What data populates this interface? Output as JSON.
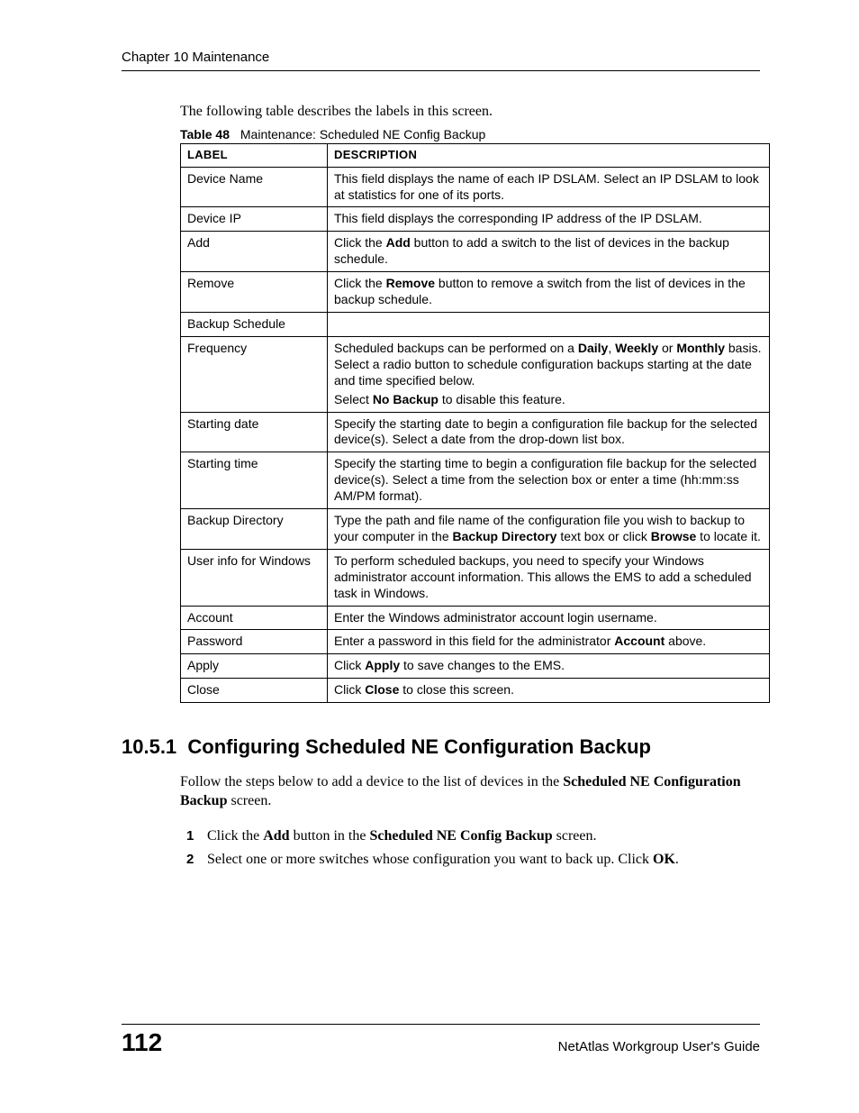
{
  "header": {
    "chapter": "Chapter 10 Maintenance"
  },
  "intro": "The following table describes the labels in this screen.",
  "table": {
    "number": "Table 48",
    "title": "Maintenance: Scheduled NE Config Backup",
    "columns": {
      "label": "LABEL",
      "description": "DESCRIPTION"
    },
    "rows": [
      {
        "label": "Device Name",
        "desc_html": "This field displays the name of each IP DSLAM. Select an IP DSLAM to look at statistics for one of its ports."
      },
      {
        "label": "Device IP",
        "desc_html": "This field displays the corresponding IP address of the IP DSLAM."
      },
      {
        "label": "Add",
        "desc_html": "Click the <b>Add</b> button to add a switch to the list of devices in the backup schedule."
      },
      {
        "label": "Remove",
        "desc_html": "Click the <b>Remove</b> button to remove a switch from the list of devices in the backup schedule."
      },
      {
        "label": "Backup Schedule",
        "desc_html": ""
      },
      {
        "label": "Frequency",
        "desc_html": "Scheduled backups can be performed on a <b>Daily</b>, <b>Weekly</b> or <b>Monthly</b> basis. Select a radio button to schedule configuration backups starting at the date and time specified below.<div class='p2'>Select <b>No Backup</b> to disable this feature.</div>"
      },
      {
        "label": "Starting date",
        "desc_html": "Specify the starting date to begin a configuration file backup for the selected device(s). Select a date from the drop-down list box."
      },
      {
        "label": "Starting time",
        "desc_html": "Specify the starting time to begin a configuration file backup for the selected device(s). Select a time from the selection box or enter a time (hh:mm:ss AM/PM format)."
      },
      {
        "label": "Backup Directory",
        "desc_html": "Type the path and file name of the configuration file you wish to backup to your computer in the <b>Backup Directory</b> text box or click <b>Browse</b> to locate it."
      },
      {
        "label": "User info for Windows",
        "desc_html": "To perform scheduled backups, you need to specify your Windows administrator account information. This allows the EMS to add a scheduled task in Windows."
      },
      {
        "label": "Account",
        "desc_html": "Enter the Windows administrator account login username."
      },
      {
        "label": "Password",
        "desc_html": "Enter a password in this field for the administrator <b>Account</b> above."
      },
      {
        "label": "Apply",
        "desc_html": "Click <b>Apply</b> to save changes to the EMS."
      },
      {
        "label": "Close",
        "desc_html": "Click <b>Close</b> to close this screen."
      }
    ]
  },
  "section": {
    "number": "10.5.1",
    "title": "Configuring Scheduled NE Configuration Backup",
    "para_html": "Follow the steps below to add a device to the list of devices in the <b>Scheduled NE Configuration Backup</b> screen.",
    "steps": [
      "Click the <b>Add</b> button in the <b>Scheduled NE Config Backup</b> screen.",
      "Select one or more switches whose configuration you want to back up. Click <b>OK</b>."
    ]
  },
  "footer": {
    "page": "112",
    "guide": "NetAtlas Workgroup User's Guide"
  }
}
